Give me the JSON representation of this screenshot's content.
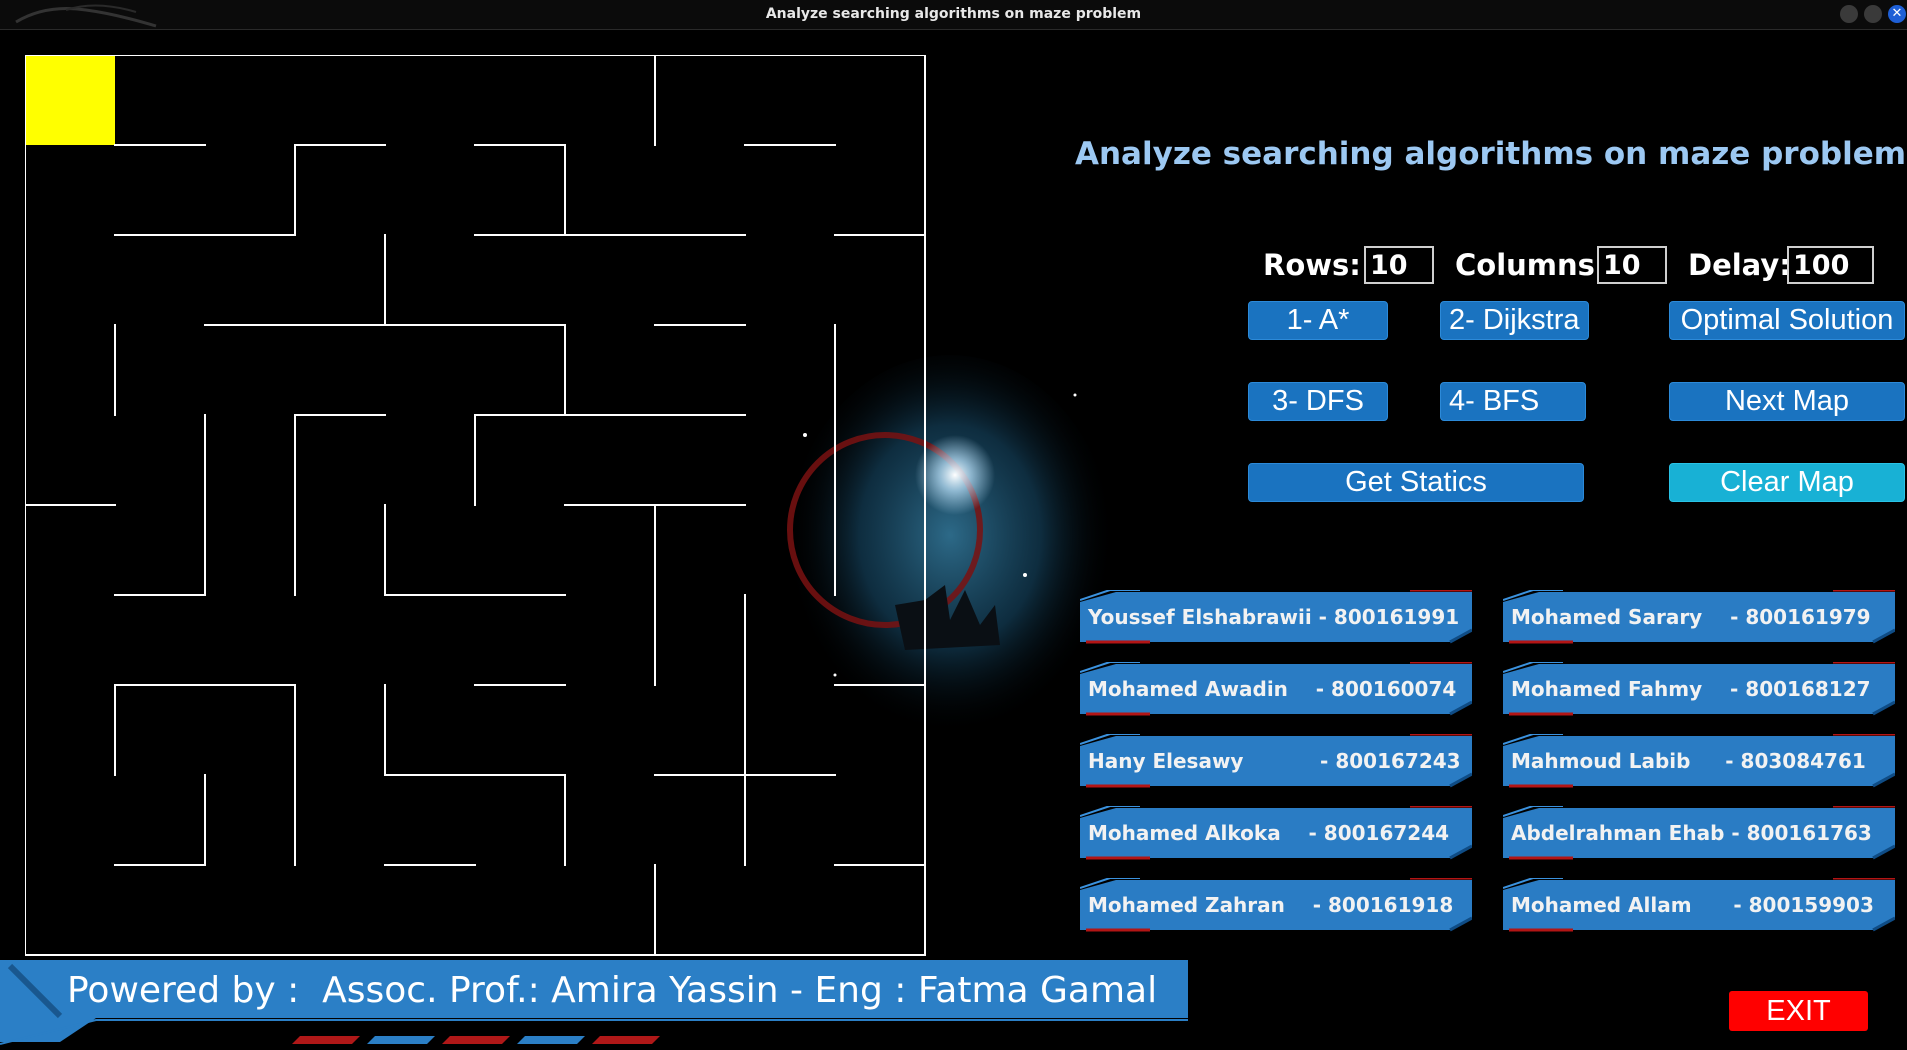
{
  "window": {
    "title": "Analyze searching algorithms on maze problem"
  },
  "app": {
    "title": "Analyze searching algorithms on maze problem",
    "fields": {
      "rows": {
        "label": "Rows:",
        "value": "10"
      },
      "columns": {
        "label": "Columns:",
        "value": "10"
      },
      "delay": {
        "label": "Delay:",
        "value": "100"
      }
    },
    "buttons": {
      "astar": "1- A*",
      "dijkstra": "2- Dijkstra",
      "optimal": "Optimal Solution",
      "dfs": "3- DFS",
      "bfs": "4- BFS",
      "next_map": "Next Map",
      "statics": "Get Statics",
      "clear_map": "Clear Map",
      "exit": "EXIT"
    },
    "team": [
      "Youssef Elshabrawii - 800161991",
      "Mohamed Sarary    - 800161979",
      "Mohamed Awadin    - 800160074",
      "Mohamed Fahmy    - 800168127",
      "Hany Elesawy           - 800167243",
      "Mahmoud Labib     - 803084761",
      "Mohamed Alkoka    - 800167244",
      "Abdelrahman Ehab - 800161763",
      "Mohamed Zahran    - 800161918",
      "Mohamed Allam      - 800159903"
    ],
    "footer": "Powered by :  Assoc. Prof.: Amira Yassin - Eng : Fatma Gamal"
  },
  "maze": {
    "rows": 10,
    "columns": 10,
    "start_cell": [
      0,
      0
    ]
  },
  "colors": {
    "start_cell": "#ffff00",
    "wall": "#ffffff",
    "title": "#9cc8f2",
    "button": "#1a73c0",
    "button_highlight": "#18b1d5",
    "exit": "#ff0000"
  }
}
